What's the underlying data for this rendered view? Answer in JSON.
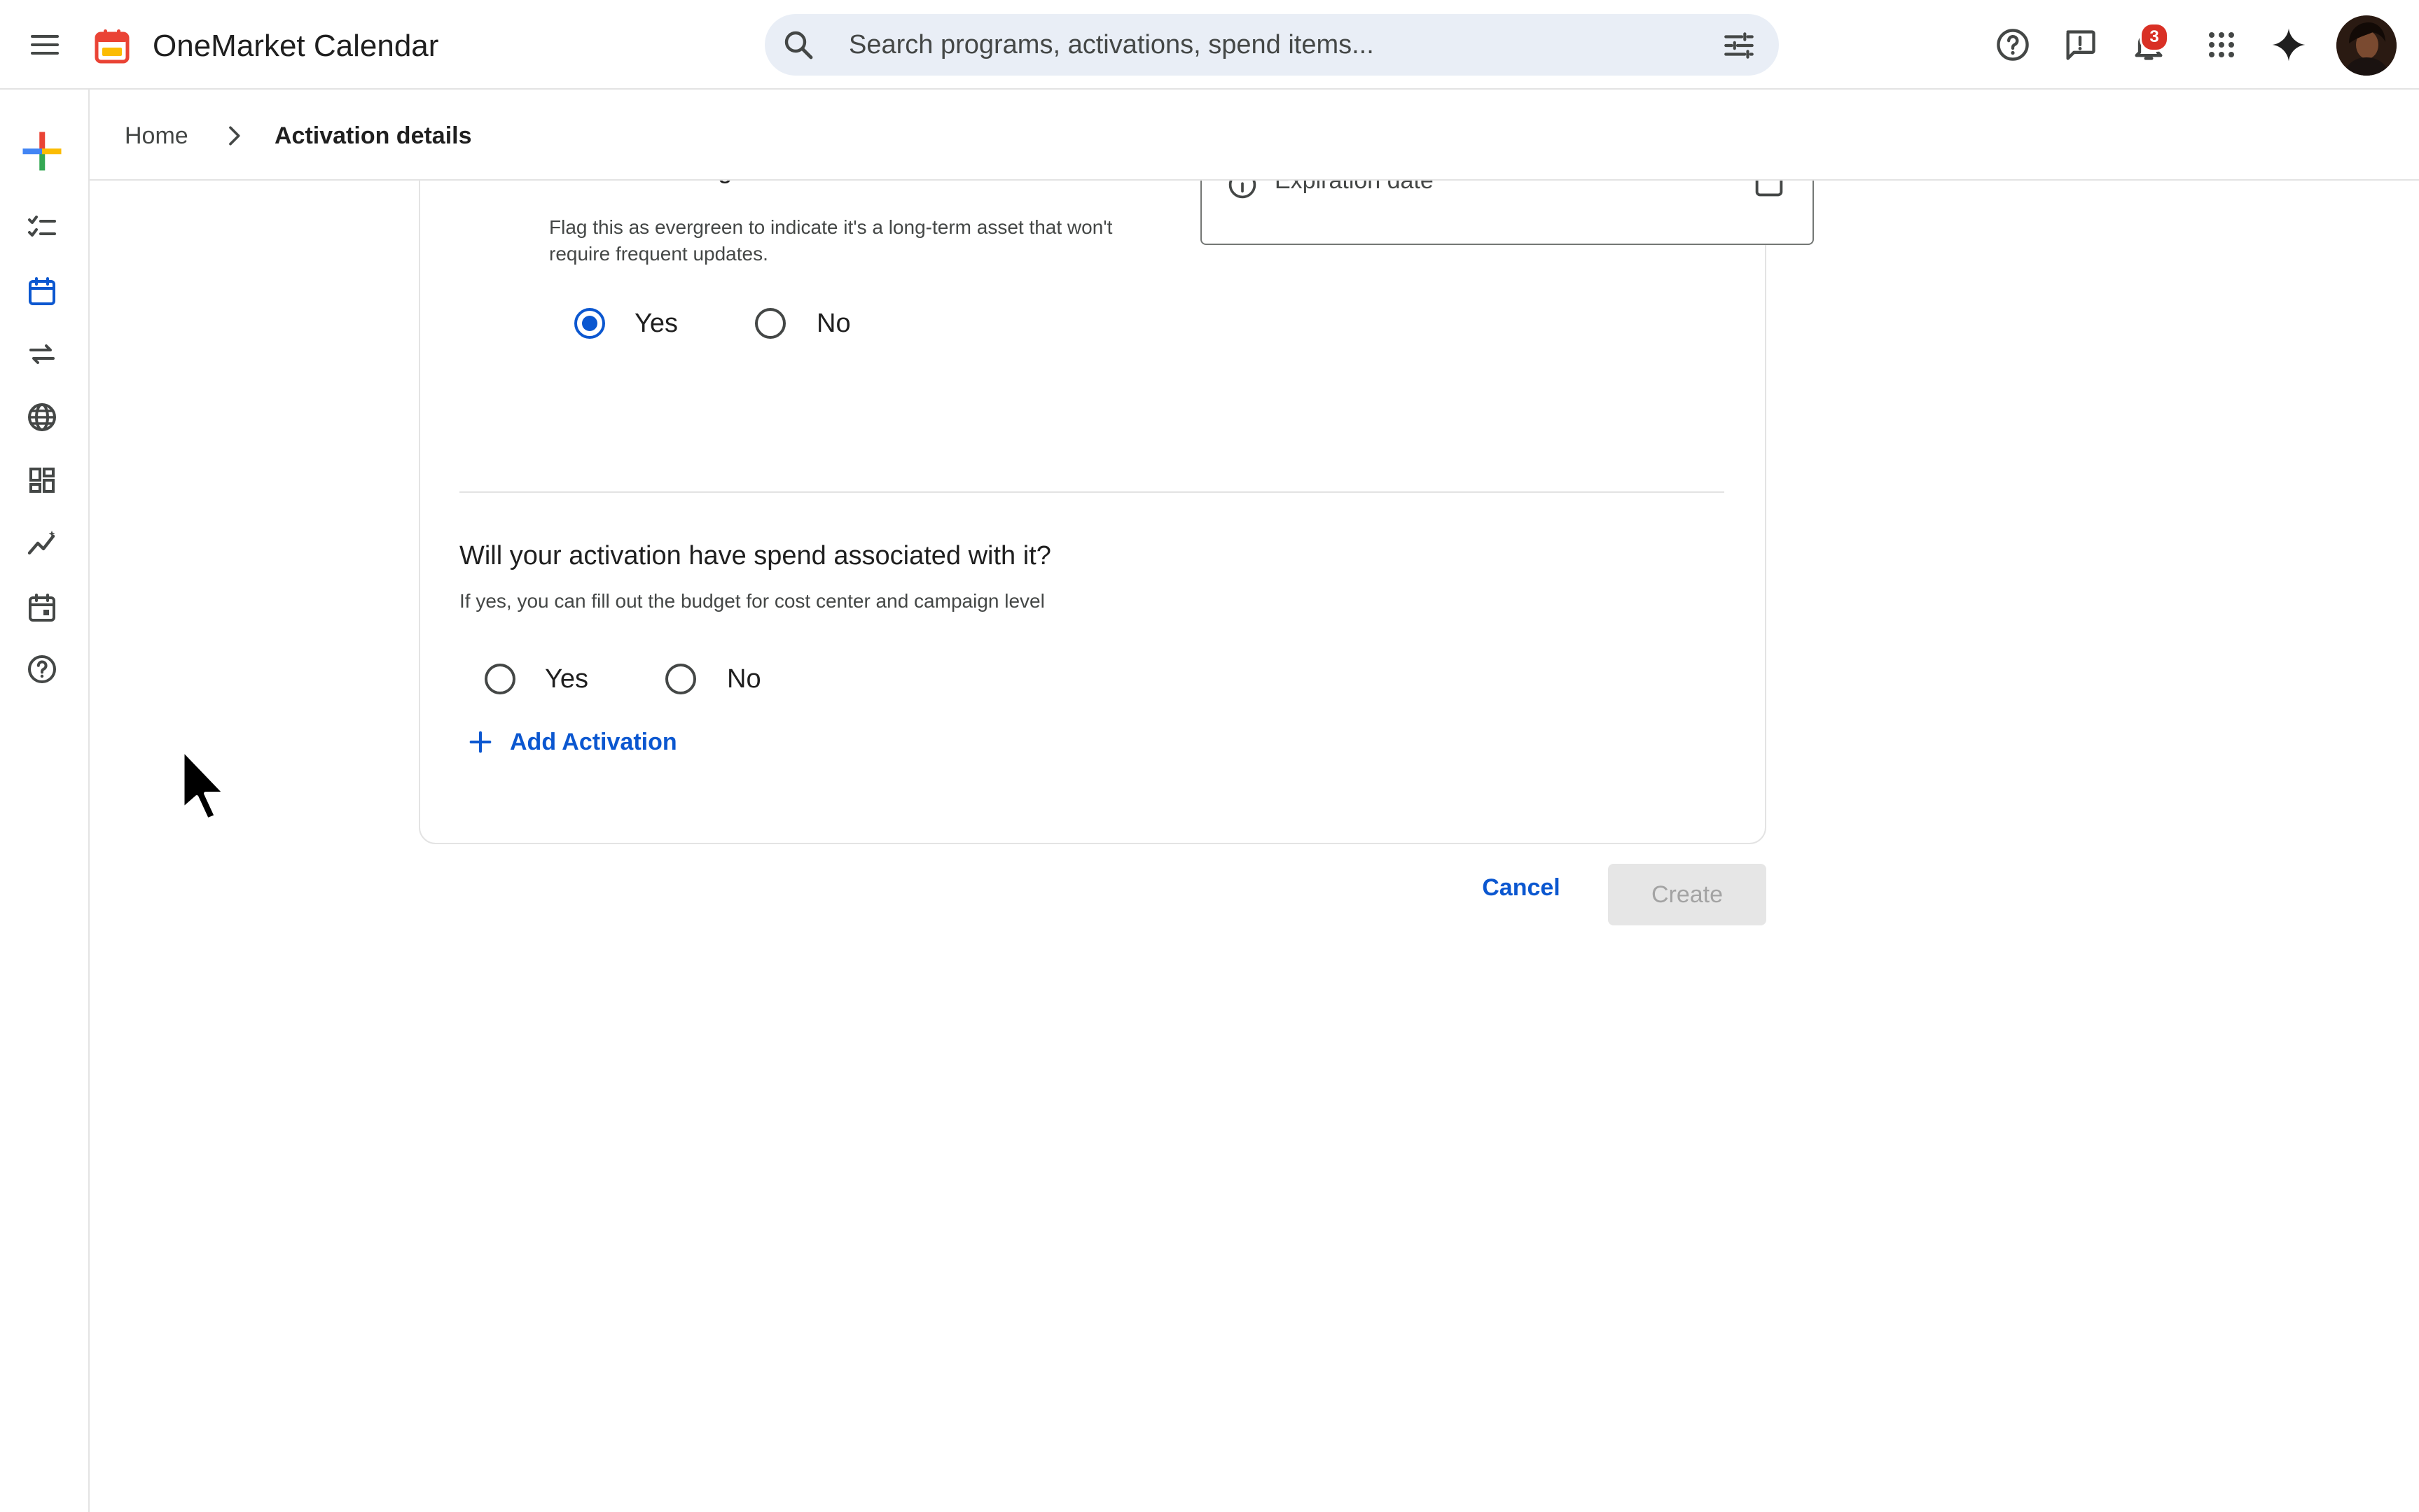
{
  "app": {
    "title": "OneMarket Calendar"
  },
  "search": {
    "placeholder": "Search programs, activations, spend items..."
  },
  "header": {
    "notification_count": "3",
    "icons": [
      "help-icon",
      "feedback-icon",
      "notifications-icon",
      "apps-grid-icon",
      "sparkle-icon"
    ]
  },
  "rail": {
    "items": [
      "create-icon",
      "tasks-icon",
      "calendar-icon",
      "swap-icon",
      "globe-icon",
      "dashboard-icon",
      "insights-icon",
      "event-icon",
      "help-icon"
    ]
  },
  "breadcrumb": {
    "home": "Home",
    "current": "Activation details"
  },
  "form": {
    "evergreen": {
      "title": "Is this an Evergreen activation?",
      "help": "Flag this as evergreen to indicate it's a long-term asset that won't require frequent updates.",
      "options": [
        "Yes",
        "No"
      ],
      "selected": "Yes"
    },
    "expiration": {
      "placeholder": "Expiration date*"
    },
    "spend": {
      "title": "Will your activation have spend associated with it?",
      "help": "If yes, you can fill out the budget for cost center and campaign level",
      "options": [
        "Yes",
        "No"
      ],
      "selected": ""
    },
    "add_activation": "Add Activation",
    "cancel": "Cancel",
    "create": "Create"
  },
  "colors": {
    "accent": "#0b57d0",
    "badge": "#d93025",
    "disabled_bg": "#e6e6e6"
  }
}
